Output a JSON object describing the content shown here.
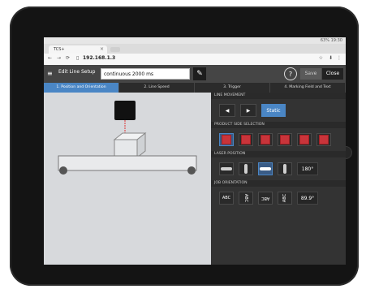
{
  "os": {
    "status_right": "63% 19:30"
  },
  "browser": {
    "tab_title": "TCS+",
    "url": "192.168.1.3",
    "icons": [
      "back-icon",
      "forward-icon",
      "refresh-icon",
      "star-icon",
      "mic-icon",
      "menu-icon"
    ]
  },
  "app": {
    "title": "Edit Line Setup",
    "line_name": "continuous 2000 ms",
    "help_label": "?",
    "save_label": "Save",
    "close_label": "Close",
    "steps": [
      "1. Position and Orientation",
      "2. Line Speed",
      "3. Trigger",
      "4. Marking Field and Text"
    ],
    "sections": {
      "line_movement": "LINE MOVEMENT",
      "product_side": "PRODUCT SIDE SELECTION",
      "laser_position": "LASER POSITION",
      "job_orientation": "JOB ORIENTATION"
    },
    "static_label": "Static",
    "laser_angle": "180°",
    "job_angle": "89.9°",
    "orientation_labels": [
      "ABC",
      "ABC",
      "ABC",
      "ABC"
    ],
    "accent": "#4a86c5"
  }
}
